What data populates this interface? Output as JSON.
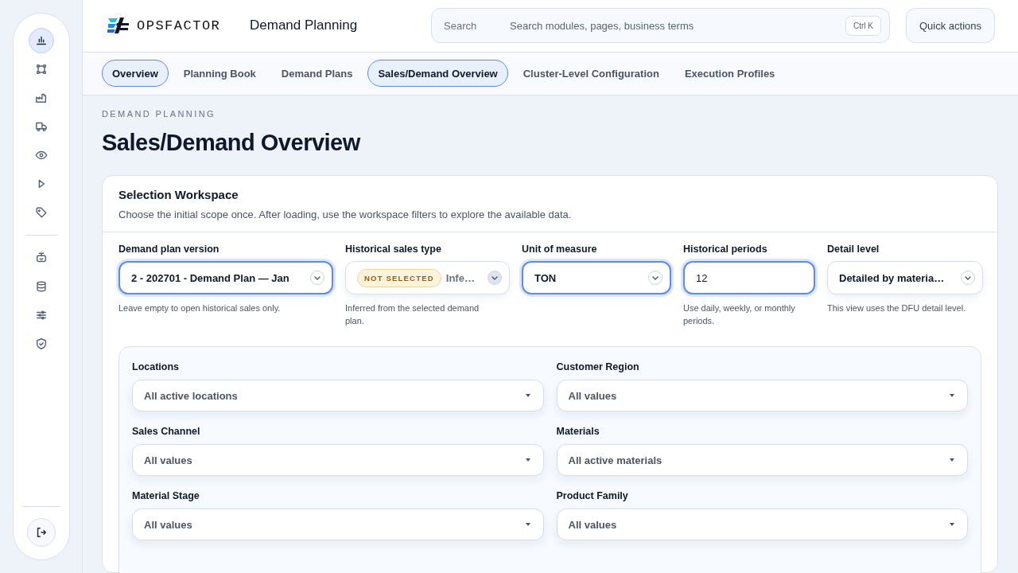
{
  "sidebar": {
    "items": [
      {
        "selected": true
      },
      {
        "selected": false
      },
      {
        "selected": false
      },
      {
        "selected": false
      },
      {
        "selected": false
      },
      {
        "selected": false
      },
      {
        "selected": false
      },
      {
        "selected": false
      },
      {
        "selected": false
      },
      {
        "selected": false
      },
      {
        "selected": false
      }
    ]
  },
  "header": {
    "brand": "OPSFACTOR",
    "module": "Demand Planning",
    "search": {
      "label": "Search",
      "placeholder": "Search modules, pages, business terms",
      "shortcut": "Ctrl K"
    },
    "action": "Quick actions"
  },
  "tabs": [
    {
      "label": "Overview",
      "selected": true
    },
    {
      "label": "Planning Book",
      "selected": false
    },
    {
      "label": "Demand Plans",
      "selected": false
    },
    {
      "label": "Sales/Demand Overview",
      "selected": true
    },
    {
      "label": "Cluster-Level Configuration",
      "selected": false
    },
    {
      "label": "Execution Profiles",
      "selected": false
    }
  ],
  "page": {
    "eyebrow": "DEMAND PLANNING",
    "title": "Sales/Demand Overview"
  },
  "workspace": {
    "title": "Selection Workspace",
    "description": "Choose the initial scope once. After loading, use the workspace filters to explore the available data.",
    "fields": [
      {
        "kind": "select",
        "label": "Demand plan version",
        "value": "2 - 202701 - Demand Plan — Jan",
        "hint": "Leave empty to open historical sales only.",
        "highlighted": true,
        "disabled": false
      },
      {
        "kind": "select",
        "label": "Historical sales type",
        "badge": "NOT SELECTED",
        "value": "Infe…",
        "hint": "Inferred from the selected demand plan.",
        "highlighted": false,
        "disabled": true
      },
      {
        "kind": "select",
        "label": "Unit of measure",
        "value": "TON",
        "highlighted": true,
        "disabled": false
      },
      {
        "kind": "input",
        "label": "Historical periods",
        "value": "12",
        "hint": "Use daily, weekly, or monthly periods.",
        "highlighted": true,
        "disabled": false
      },
      {
        "kind": "select",
        "label": "Detail level",
        "value": "Detailed by materia…",
        "hint": "This view uses the DFU detail level.",
        "highlighted": false,
        "disabled": false
      }
    ],
    "filters": [
      {
        "label": "Locations",
        "value": "All active locations"
      },
      {
        "label": "Customer Region",
        "value": "All values"
      },
      {
        "label": "Sales Channel",
        "value": "All values"
      },
      {
        "label": "Materials",
        "value": "All active materials"
      },
      {
        "label": "Material Stage",
        "value": "All values"
      },
      {
        "label": "Product Family",
        "value": "All values"
      }
    ]
  }
}
